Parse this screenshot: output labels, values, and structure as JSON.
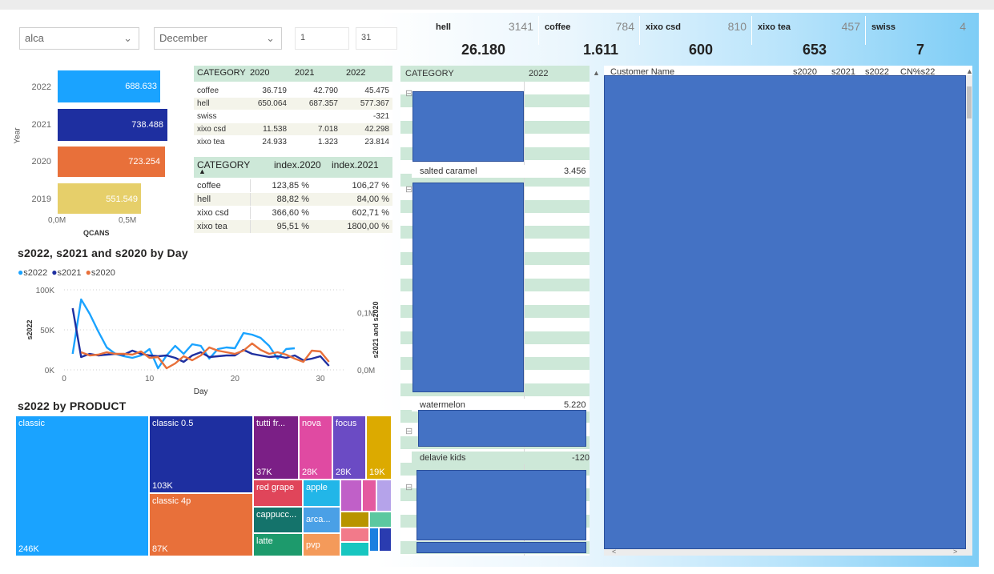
{
  "slicers": {
    "customer": {
      "value": "alca"
    },
    "month": {
      "value": "December"
    },
    "day_from": "1",
    "day_to": "31"
  },
  "kpis": [
    {
      "name": "hell",
      "small": "3141",
      "big": "26.180"
    },
    {
      "name": "coffee",
      "small": "784",
      "big": "1.611"
    },
    {
      "name": "xixo csd",
      "small": "810",
      "big": "600"
    },
    {
      "name": "xixo tea",
      "small": "457",
      "big": "653"
    },
    {
      "name": "swiss",
      "small": "4",
      "big": "7"
    }
  ],
  "year_bar": {
    "ylabel": "Year",
    "xlabel": "QCANS",
    "ticks": [
      "0,0M",
      "0,5M"
    ],
    "bars": [
      {
        "year": "2022",
        "label": "688.633",
        "color": "#1aa3ff"
      },
      {
        "year": "2021",
        "label": "738.488",
        "color": "#1e2fa0"
      },
      {
        "year": "2020",
        "label": "723.254",
        "color": "#e8703a"
      },
      {
        "year": "2019",
        "label": "551.549",
        "color": "#e6cf6a"
      }
    ]
  },
  "year_table": {
    "headers": [
      "CATEGORY",
      "2020",
      "2021",
      "2022"
    ],
    "rows": [
      [
        "coffee",
        "36.719",
        "42.790",
        "45.475"
      ],
      [
        "hell",
        "650.064",
        "687.357",
        "577.367"
      ],
      [
        "swiss",
        "",
        "",
        "-321"
      ],
      [
        "xixo csd",
        "11.538",
        "7.018",
        "42.298"
      ],
      [
        "xixo tea",
        "24.933",
        "1.323",
        "23.814"
      ]
    ]
  },
  "index_table": {
    "headers": [
      "CATEGORY",
      "index.2020",
      "index.2021"
    ],
    "rows": [
      [
        "coffee",
        "123,85 %",
        "106,27 %"
      ],
      [
        "hell",
        "88,82 %",
        "84,00 %"
      ],
      [
        "xixo csd",
        "366,60 %",
        "602,71 %"
      ],
      [
        "xixo tea",
        "95,51 %",
        "1800,00 %"
      ]
    ]
  },
  "line_chart_title": "s2022, s2021 and s2020 by Day",
  "line_legend": [
    {
      "name": "s2022",
      "color": "#1aa3ff"
    },
    {
      "name": "s2021",
      "color": "#1e2fa0"
    },
    {
      "name": "s2020",
      "color": "#e8703a"
    }
  ],
  "chart_data": {
    "type": "line",
    "title": "s2022, s2021 and s2020 by Day",
    "xlabel": "Day",
    "ylabel": "s2022",
    "y2label": "s2021 and s2020",
    "xlim": [
      0,
      33
    ],
    "ylim": [
      0,
      100000
    ],
    "y2lim": [
      0,
      140000
    ],
    "xticks": [
      "0",
      "10",
      "20",
      "30"
    ],
    "yticks": [
      "0K",
      "50K",
      "100K"
    ],
    "y2ticks": [
      "0,0M",
      "0,1M"
    ],
    "x": [
      1,
      2,
      3,
      4,
      5,
      6,
      7,
      8,
      9,
      10,
      11,
      12,
      13,
      14,
      15,
      16,
      17,
      18,
      19,
      20,
      21,
      22,
      23,
      24,
      25,
      26,
      27,
      28,
      29,
      30,
      31
    ],
    "series": [
      {
        "name": "s2022",
        "axis": "left",
        "color": "#1aa3ff",
        "values": [
          20000,
          88000,
          70000,
          48000,
          28000,
          20000,
          17000,
          15000,
          18000,
          26000,
          2000,
          18000,
          30000,
          20000,
          32000,
          30000,
          14000,
          26000,
          28000,
          27000,
          46000,
          44000,
          40000,
          30000,
          14000,
          26000,
          27000,
          null,
          null,
          null,
          null
        ]
      },
      {
        "name": "s2021",
        "axis": "left",
        "color": "#1e2fa0",
        "values": [
          77000,
          16000,
          20000,
          18000,
          19000,
          20000,
          19000,
          24000,
          20000,
          18000,
          17000,
          18000,
          15000,
          10000,
          18000,
          22000,
          16000,
          17000,
          18000,
          18000,
          25000,
          20000,
          18000,
          16000,
          17000,
          15000,
          18000,
          12000,
          14000,
          17000,
          5000
        ]
      },
      {
        "name": "s2020",
        "axis": "left",
        "color": "#e8703a",
        "values": [
          null,
          22000,
          18000,
          19000,
          22000,
          20000,
          20000,
          19000,
          23000,
          15000,
          16000,
          2000,
          8000,
          17000,
          12000,
          18000,
          28000,
          24000,
          22000,
          20000,
          24000,
          33000,
          25000,
          20000,
          22000,
          19000,
          14000,
          10000,
          24000,
          23000,
          10000
        ]
      }
    ]
  },
  "treemap_title": "s2022 by PRODUCT",
  "treemap": [
    {
      "name": "classic",
      "value": "246K",
      "color": "#1aa3ff"
    },
    {
      "name": "classic 0.5",
      "value": "103K",
      "color": "#1e2fa0"
    },
    {
      "name": "classic 4p",
      "value": "87K",
      "color": "#e8703a"
    },
    {
      "name": "tutti fr...",
      "value": "37K",
      "color": "#7b1f86"
    },
    {
      "name": "nova",
      "value": "28K",
      "color": "#e04aa2"
    },
    {
      "name": "focus",
      "value": "28K",
      "color": "#6b4bc4"
    },
    {
      "name": "",
      "value": "19K",
      "color": "#dcaa00"
    },
    {
      "name": "red grape",
      "value": "",
      "color": "#e0455a"
    },
    {
      "name": "apple",
      "value": "",
      "color": "#22b6e8"
    },
    {
      "name": "cappucc...",
      "value": "",
      "color": "#14736b"
    },
    {
      "name": "arca...",
      "value": "",
      "color": "#4aa0e6"
    },
    {
      "name": "latte",
      "value": "",
      "color": "#1d9a6c"
    },
    {
      "name": "pvp",
      "value": "",
      "color": "#f49a5a"
    }
  ],
  "middle_table": {
    "headers": [
      "CATEGORY",
      "2022"
    ],
    "rows": [
      {
        "name": "salted caramel",
        "value": "3.456"
      },
      {
        "name": "watermelon",
        "value": "5.220"
      },
      {
        "name": "delavie kids",
        "value": "-120"
      }
    ]
  },
  "right_table": {
    "headers": [
      "Customer Name",
      "s2020",
      "s2021",
      "s2022",
      "CN%s22"
    ]
  }
}
